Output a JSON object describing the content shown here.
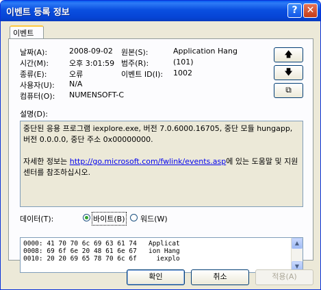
{
  "window": {
    "title": "이벤트 등록 정보",
    "help_glyph": "?",
    "close_glyph": "✕"
  },
  "tab": {
    "label": "이벤트"
  },
  "fields": {
    "date_label": "날짜(A):",
    "date_value": "2008-09-02",
    "time_label": "시간(M):",
    "time_value": "오후 3:01:59",
    "type_label": "종류(E):",
    "type_value": "오류",
    "user_label": "사용자(U):",
    "user_value": "N/A",
    "computer_label": "컴퓨터(O):",
    "computer_value": "NUMENSOFT-C",
    "source_label": "원본(S):",
    "source_value": "Application Hang",
    "category_label": "범주(R):",
    "category_value": "(101)",
    "eventid_label": "이벤트 ID(I):",
    "eventid_value": "1002"
  },
  "nav_buttons": {
    "up_glyph": "🡅",
    "down_glyph": "🡇",
    "copy_glyph": "⧉"
  },
  "description": {
    "label": "설명(D):",
    "line1": "중단된 응용 프로그램 iexplore.exe, 버전 7.0.6000.16705, 중단 모듈 hungapp, 버전 0.0.0.0, 중단 주소 0x00000000.",
    "line2_prefix": "자세한 정보는 ",
    "link": "http://go.microsoft.com/fwlink/events.asp",
    "line2_suffix": "에 있는 도움말 및 지원 센터를 참조하십시오."
  },
  "data_section": {
    "label": "데이터(T):",
    "radio_bytes": "바이트(B)",
    "radio_words": "워드(W)",
    "selected": "bytes",
    "lines": [
      "0000: 41 70 70 6c 69 63 61 74   Applicat",
      "0008: 69 6f 6e 20 48 61 6e 67   ion Hang",
      "0010: 20 20 69 65 78 70 6c 6f     iexplo"
    ]
  },
  "buttons": {
    "ok": "확인",
    "cancel": "취소",
    "apply": "적용(A)"
  }
}
